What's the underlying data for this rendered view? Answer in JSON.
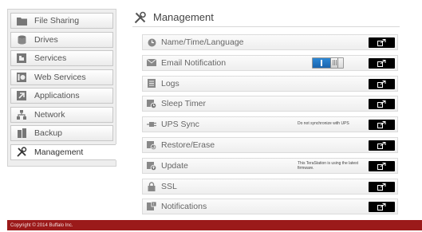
{
  "sidebar": {
    "items": [
      {
        "label": "File Sharing",
        "icon": "folder-icon"
      },
      {
        "label": "Drives",
        "icon": "drive-icon"
      },
      {
        "label": "Services",
        "icon": "puzzle-icon"
      },
      {
        "label": "Web Services",
        "icon": "web-service-icon"
      },
      {
        "label": "Applications",
        "icon": "applications-icon"
      },
      {
        "label": "Network",
        "icon": "network-icon"
      },
      {
        "label": "Backup",
        "icon": "backup-icon"
      },
      {
        "label": "Management",
        "icon": "tools-icon",
        "active": true
      }
    ]
  },
  "main": {
    "title": "Management",
    "rows": [
      {
        "label": "Name/Time/Language",
        "icon": "clock-icon"
      },
      {
        "label": "Email Notification",
        "icon": "mail-icon",
        "toggle": "on"
      },
      {
        "label": "Logs",
        "icon": "logs-icon"
      },
      {
        "label": "Sleep Timer",
        "icon": "sleep-timer-icon"
      },
      {
        "label": "UPS Sync",
        "icon": "plug-icon",
        "note": "Do not synchronize with UPS"
      },
      {
        "label": "Restore/Erase",
        "icon": "restore-icon"
      },
      {
        "label": "Update",
        "icon": "update-icon",
        "note": "This TeraStation is using the latest\nfirmware."
      },
      {
        "label": "SSL",
        "icon": "lock-icon"
      },
      {
        "label": "Notifications",
        "icon": "notifications-icon"
      }
    ]
  },
  "footer": {
    "copyright": "Copyright © 2014 Buffalo Inc."
  },
  "colors": {
    "footer_bg": "#9b1a1a",
    "toggle_on": "#1f6fbd",
    "button_bg": "#000000"
  }
}
